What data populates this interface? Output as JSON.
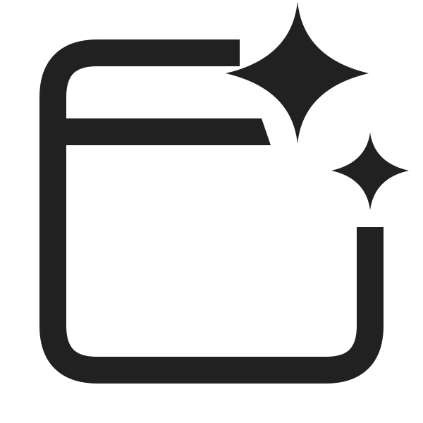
{
  "icon": {
    "name": "window-sparkle-icon",
    "color": "#212121",
    "background": "#ffffff"
  }
}
